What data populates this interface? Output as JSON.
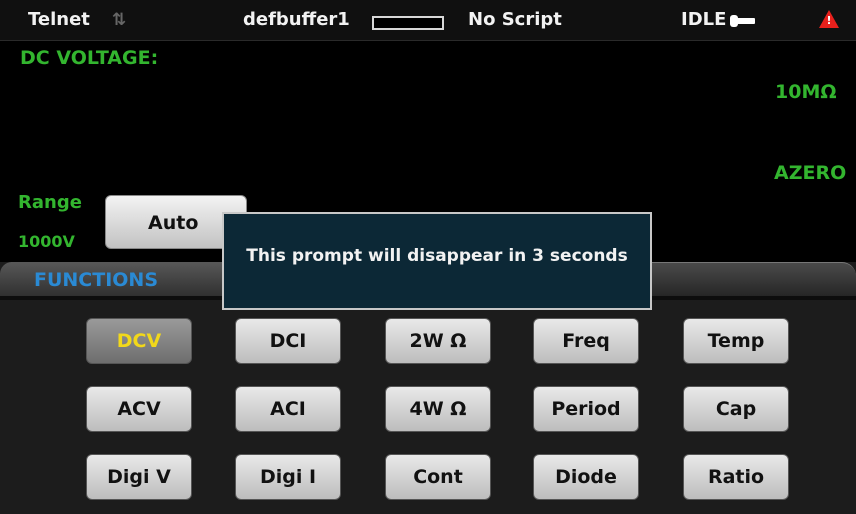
{
  "statusbar": {
    "connection": "Telnet",
    "buffer_name": "defbuffer1",
    "script": "No Script",
    "state": "IDLE"
  },
  "measurement": {
    "function_title": "DC VOLTAGE:",
    "input_impedance": "10MΩ",
    "autozero": "AZERO",
    "range_label": "Range",
    "range_value": "1000V",
    "range_button": "Auto"
  },
  "functions": {
    "tab_label": "FUNCTIONS",
    "selected": "DCV",
    "rows": [
      [
        "DCV",
        "DCI",
        "2W Ω",
        "Freq",
        "Temp"
      ],
      [
        "ACV",
        "ACI",
        "4W Ω",
        "Period",
        "Cap"
      ],
      [
        "Digi V",
        "Digi I",
        "Cont",
        "Diode",
        "Ratio"
      ]
    ]
  },
  "prompt": {
    "message": "This prompt will disappear in 3 seconds"
  },
  "colors": {
    "accent_green": "#33b52f",
    "tab_blue": "#2a8ad4",
    "selected_yellow": "#f2d81a",
    "warning_red": "#e8201c",
    "prompt_bg": "#0c2836"
  },
  "icons": {
    "connection_activity": "updown-arrows-icon",
    "idle": "plug-icon",
    "warning": "warning-triangle-icon"
  }
}
